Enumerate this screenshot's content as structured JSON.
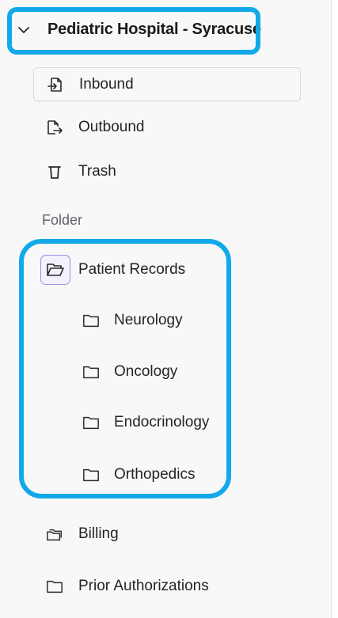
{
  "organization": {
    "name": "Pediatric Hospital - Syracuse"
  },
  "mailboxes": [
    {
      "label": "Inbound",
      "icon": "inbound-icon"
    },
    {
      "label": "Outbound",
      "icon": "outbound-icon"
    },
    {
      "label": "Trash",
      "icon": "trash-icon"
    }
  ],
  "folder_section": {
    "label": "Folder",
    "open_folder": {
      "label": "Patient Records",
      "icon": "folder-open-icon"
    },
    "subfolders": [
      {
        "label": "Neurology",
        "icon": "folder-icon"
      },
      {
        "label": "Oncology",
        "icon": "folder-icon"
      },
      {
        "label": "Endocrinology",
        "icon": "folder-icon"
      },
      {
        "label": "Orthopedics",
        "icon": "folder-icon"
      }
    ],
    "other_folders": [
      {
        "label": "Billing",
        "icon": "folder-stack-icon"
      },
      {
        "label": "Prior Authorizations",
        "icon": "folder-icon"
      }
    ]
  },
  "colors": {
    "highlight": "#12a9e8",
    "open_folder_accent": "#9a8ddd"
  }
}
